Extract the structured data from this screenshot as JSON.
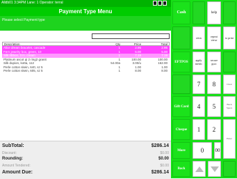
{
  "topbar": {
    "info": "Alldb01 3:34PM Lane: 1 Operator: terral"
  },
  "title": "Payment Type Menu",
  "prompt": "Please select Payment type",
  "table": {
    "headers": {
      "desc": "Description",
      "qty": "Qty",
      "price": "Price",
      "total": "Total"
    },
    "rows": [
      {
        "desc": "Alice dream bracelet, cascade",
        "qty": "1",
        "price": "2.95",
        "total": "2.95",
        "state": "sel"
      },
      {
        "desc": "Fern jewelry box, green, 10",
        "qty": "1",
        "price": "5.00",
        "total": "5.00",
        "state": "sel"
      },
      {
        "desc": "Silk ribbon, 3 in. cream",
        "qty": "1",
        "price": "7.19",
        "total": "7.19",
        "state": "alt"
      },
      {
        "desc": "Platinum ascot qi 2 ring2 granit",
        "qty": "1",
        "price": "100.00",
        "total": "100.00",
        "state": ""
      },
      {
        "desc": "Silk dupion, kotta, 112",
        "qty": "54.00a",
        "price": "3.00/u",
        "total": "162.00",
        "state": ""
      },
      {
        "desc": "Perle cotton skein, 640, sz 5",
        "qty": "1",
        "price": "1.00",
        "total": "1.00",
        "state": ""
      },
      {
        "desc": "Perle cotton skein, 605, sz 5",
        "qty": "1",
        "price": "8.00",
        "total": "8.00",
        "state": ""
      }
    ]
  },
  "summary": {
    "subtotal_label": "SubTotal:",
    "subtotal": "$286.14",
    "discount_label": "Discount:",
    "discount": "$0.00",
    "rounding_label": "Rounding:",
    "rounding": "$0.00",
    "tendered_label": "Amount Tendered:",
    "tendered": "$0.00",
    "due_label": "Amount Due:",
    "due": "$286.14"
  },
  "buttons": {
    "cash": "Cash",
    "help": "help",
    "eftpos": "EFTPOS",
    "gift_card": "Gift Card",
    "cheque": "Cheque",
    "more": "More",
    "back": "Back",
    "mini_1": "retrn",
    "mini_2": "repeat viewr",
    "mini_3": "to print",
    "mini_4": "apply metric",
    "mini_5": "secure gsoc",
    "side_1": "Clear",
    "side_2": "Back Space",
    "side_3": "Enter",
    "keys": [
      "7",
      "8",
      "9",
      "4",
      "5",
      "6",
      "1",
      "2",
      "3",
      "0",
      "00"
    ]
  }
}
